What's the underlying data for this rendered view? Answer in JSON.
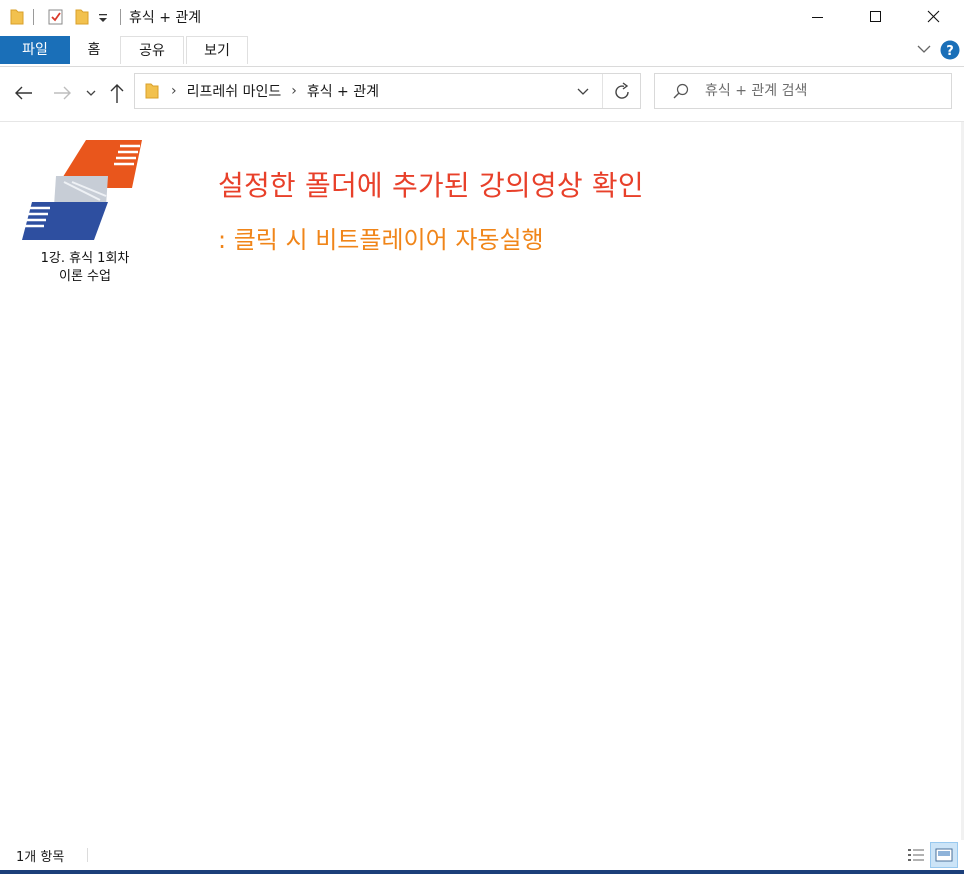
{
  "window": {
    "title": "휴식 + 관계",
    "controls": {
      "minimize": "minimize-icon",
      "maximize": "maximize-icon",
      "close": "close-icon"
    }
  },
  "ribbon": {
    "tabs": [
      {
        "label": "파일",
        "active": true
      },
      {
        "label": "홈"
      },
      {
        "label": "공유"
      },
      {
        "label": "보기"
      }
    ]
  },
  "navigation": {
    "breadcrumb": [
      "리프레쉬 마인드",
      "휴식 + 관계"
    ],
    "search_placeholder": "휴식 + 관계 검색"
  },
  "content": {
    "files": [
      {
        "line1": "1강. 휴식 1회차",
        "line2": "이론 수업",
        "icon": "video-file-logo-icon"
      }
    ],
    "annotation": {
      "headline": "설정한 폴더에 추가된 강의영상 확인",
      "subline": ": 클릭 시 비트플레이어 자동실행"
    }
  },
  "status": {
    "item_count": "1개 항목"
  },
  "colors": {
    "accent": "#1a6fb8",
    "annotation_red": "#e8402a",
    "annotation_orange": "#f08519",
    "logo_orange": "#e9561c",
    "logo_blue": "#2e4fa0"
  }
}
